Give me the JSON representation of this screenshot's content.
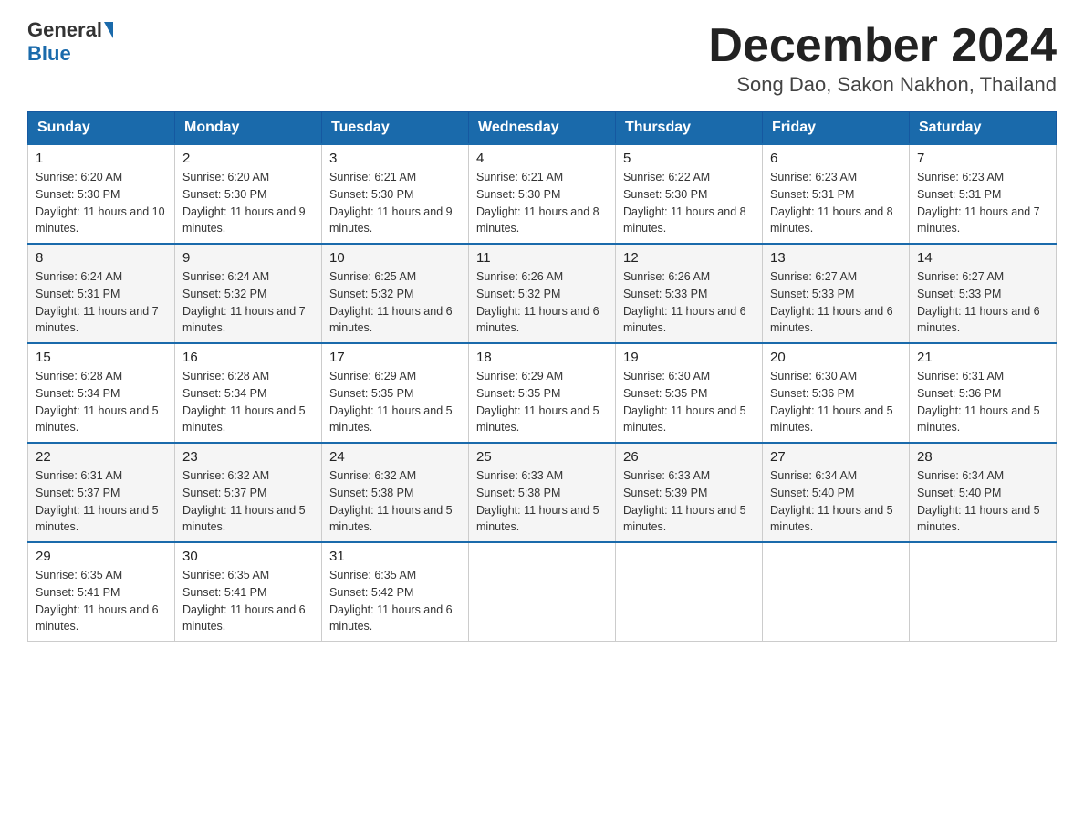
{
  "header": {
    "logo_general": "General",
    "logo_blue": "Blue",
    "title": "December 2024",
    "subtitle": "Song Dao, Sakon Nakhon, Thailand"
  },
  "days_of_week": [
    "Sunday",
    "Monday",
    "Tuesday",
    "Wednesday",
    "Thursday",
    "Friday",
    "Saturday"
  ],
  "weeks": [
    [
      {
        "day": "1",
        "sunrise": "6:20 AM",
        "sunset": "5:30 PM",
        "daylight": "11 hours and 10 minutes."
      },
      {
        "day": "2",
        "sunrise": "6:20 AM",
        "sunset": "5:30 PM",
        "daylight": "11 hours and 9 minutes."
      },
      {
        "day": "3",
        "sunrise": "6:21 AM",
        "sunset": "5:30 PM",
        "daylight": "11 hours and 9 minutes."
      },
      {
        "day": "4",
        "sunrise": "6:21 AM",
        "sunset": "5:30 PM",
        "daylight": "11 hours and 8 minutes."
      },
      {
        "day": "5",
        "sunrise": "6:22 AM",
        "sunset": "5:30 PM",
        "daylight": "11 hours and 8 minutes."
      },
      {
        "day": "6",
        "sunrise": "6:23 AM",
        "sunset": "5:31 PM",
        "daylight": "11 hours and 8 minutes."
      },
      {
        "day": "7",
        "sunrise": "6:23 AM",
        "sunset": "5:31 PM",
        "daylight": "11 hours and 7 minutes."
      }
    ],
    [
      {
        "day": "8",
        "sunrise": "6:24 AM",
        "sunset": "5:31 PM",
        "daylight": "11 hours and 7 minutes."
      },
      {
        "day": "9",
        "sunrise": "6:24 AM",
        "sunset": "5:32 PM",
        "daylight": "11 hours and 7 minutes."
      },
      {
        "day": "10",
        "sunrise": "6:25 AM",
        "sunset": "5:32 PM",
        "daylight": "11 hours and 6 minutes."
      },
      {
        "day": "11",
        "sunrise": "6:26 AM",
        "sunset": "5:32 PM",
        "daylight": "11 hours and 6 minutes."
      },
      {
        "day": "12",
        "sunrise": "6:26 AM",
        "sunset": "5:33 PM",
        "daylight": "11 hours and 6 minutes."
      },
      {
        "day": "13",
        "sunrise": "6:27 AM",
        "sunset": "5:33 PM",
        "daylight": "11 hours and 6 minutes."
      },
      {
        "day": "14",
        "sunrise": "6:27 AM",
        "sunset": "5:33 PM",
        "daylight": "11 hours and 6 minutes."
      }
    ],
    [
      {
        "day": "15",
        "sunrise": "6:28 AM",
        "sunset": "5:34 PM",
        "daylight": "11 hours and 5 minutes."
      },
      {
        "day": "16",
        "sunrise": "6:28 AM",
        "sunset": "5:34 PM",
        "daylight": "11 hours and 5 minutes."
      },
      {
        "day": "17",
        "sunrise": "6:29 AM",
        "sunset": "5:35 PM",
        "daylight": "11 hours and 5 minutes."
      },
      {
        "day": "18",
        "sunrise": "6:29 AM",
        "sunset": "5:35 PM",
        "daylight": "11 hours and 5 minutes."
      },
      {
        "day": "19",
        "sunrise": "6:30 AM",
        "sunset": "5:35 PM",
        "daylight": "11 hours and 5 minutes."
      },
      {
        "day": "20",
        "sunrise": "6:30 AM",
        "sunset": "5:36 PM",
        "daylight": "11 hours and 5 minutes."
      },
      {
        "day": "21",
        "sunrise": "6:31 AM",
        "sunset": "5:36 PM",
        "daylight": "11 hours and 5 minutes."
      }
    ],
    [
      {
        "day": "22",
        "sunrise": "6:31 AM",
        "sunset": "5:37 PM",
        "daylight": "11 hours and 5 minutes."
      },
      {
        "day": "23",
        "sunrise": "6:32 AM",
        "sunset": "5:37 PM",
        "daylight": "11 hours and 5 minutes."
      },
      {
        "day": "24",
        "sunrise": "6:32 AM",
        "sunset": "5:38 PM",
        "daylight": "11 hours and 5 minutes."
      },
      {
        "day": "25",
        "sunrise": "6:33 AM",
        "sunset": "5:38 PM",
        "daylight": "11 hours and 5 minutes."
      },
      {
        "day": "26",
        "sunrise": "6:33 AM",
        "sunset": "5:39 PM",
        "daylight": "11 hours and 5 minutes."
      },
      {
        "day": "27",
        "sunrise": "6:34 AM",
        "sunset": "5:40 PM",
        "daylight": "11 hours and 5 minutes."
      },
      {
        "day": "28",
        "sunrise": "6:34 AM",
        "sunset": "5:40 PM",
        "daylight": "11 hours and 5 minutes."
      }
    ],
    [
      {
        "day": "29",
        "sunrise": "6:35 AM",
        "sunset": "5:41 PM",
        "daylight": "11 hours and 6 minutes."
      },
      {
        "day": "30",
        "sunrise": "6:35 AM",
        "sunset": "5:41 PM",
        "daylight": "11 hours and 6 minutes."
      },
      {
        "day": "31",
        "sunrise": "6:35 AM",
        "sunset": "5:42 PM",
        "daylight": "11 hours and 6 minutes."
      },
      null,
      null,
      null,
      null
    ]
  ],
  "labels": {
    "sunrise": "Sunrise:",
    "sunset": "Sunset:",
    "daylight": "Daylight:"
  }
}
